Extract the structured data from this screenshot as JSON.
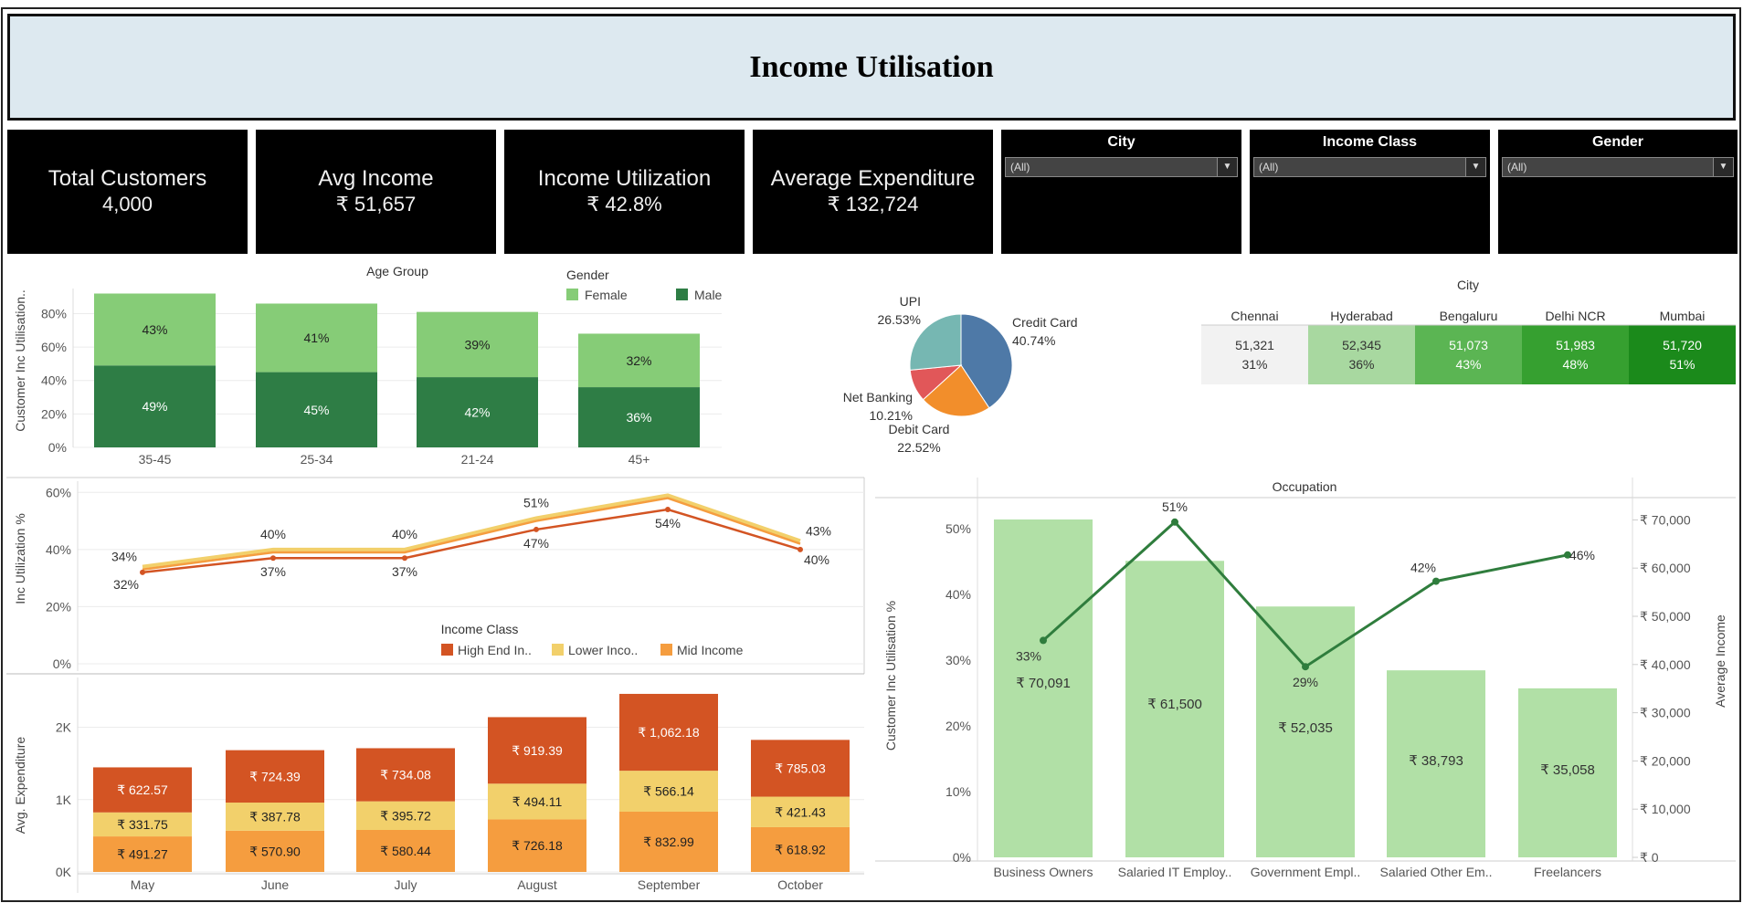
{
  "title": "Income Utilisation",
  "kpis": [
    {
      "label": "Total Customers",
      "value": "4,000"
    },
    {
      "label": "Avg Income",
      "value": "₹ 51,657"
    },
    {
      "label": "Income Utilization",
      "value": "₹ 42.8%"
    },
    {
      "label": "Average Expenditure",
      "value": "₹ 132,724"
    }
  ],
  "filters": [
    {
      "label": "City",
      "value": "(All)"
    },
    {
      "label": "Income Class",
      "value": "(All)"
    },
    {
      "label": "Gender",
      "value": "(All)"
    }
  ],
  "colors": {
    "female": "#86cc77",
    "male": "#2e7d45",
    "high_end": "#d35423",
    "lower": "#f2d06b",
    "mid": "#f59d3f",
    "occ_bar": "#b1e0a6",
    "occ_line": "#2f7d3d",
    "upi": "#76b7b2",
    "credit": "#4e79a7",
    "debit": "#f28e2b",
    "netbanking": "#e15759"
  },
  "chart_data": [
    {
      "id": "age_group",
      "type": "bar",
      "stacked": true,
      "title": "Age Group",
      "ylabel": "Customer Inc Utilisation..",
      "legend_title": "Gender",
      "categories": [
        "35-45",
        "25-34",
        "21-24",
        "45+"
      ],
      "series": [
        {
          "name": "Male",
          "values": [
            49,
            45,
            42,
            36
          ],
          "labels": [
            "49%",
            "45%",
            "42%",
            "36%"
          ]
        },
        {
          "name": "Female",
          "values": [
            43,
            41,
            39,
            32
          ],
          "labels": [
            "43%",
            "41%",
            "39%",
            "32%"
          ]
        }
      ],
      "yticks": [
        "0%",
        "20%",
        "40%",
        "60%",
        "80%"
      ],
      "ylim": [
        0,
        95
      ]
    },
    {
      "id": "payment",
      "type": "pie",
      "slices": [
        {
          "name": "Credit Card",
          "value": 40.74,
          "label": "40.74%"
        },
        {
          "name": "Debit Card",
          "value": 22.52,
          "label": "22.52%"
        },
        {
          "name": "Net Banking",
          "value": 10.21,
          "label": "10.21%"
        },
        {
          "name": "UPI",
          "value": 26.53,
          "label": "26.53%"
        }
      ]
    },
    {
      "id": "city",
      "type": "table",
      "title": "City",
      "columns": [
        "Chennai",
        "Hyderabad",
        "Bengaluru",
        "Delhi NCR",
        "Mumbai"
      ],
      "income": [
        "51,321",
        "52,345",
        "51,073",
        "51,983",
        "51,720"
      ],
      "utilisation": [
        "31%",
        "36%",
        "43%",
        "48%",
        "51%"
      ],
      "util_values": [
        31,
        36,
        43,
        48,
        51
      ],
      "fills": [
        "#f2f2f2",
        "#a8d8a0",
        "#5bb553",
        "#36a030",
        "#1b8a1b"
      ]
    },
    {
      "id": "util_trend",
      "type": "line",
      "ylabel": "Inc Utilization %",
      "legend_title": "Income Class",
      "categories": [
        "May",
        "June",
        "July",
        "August",
        "September",
        "October"
      ],
      "series": [
        {
          "name": "High End In..",
          "values": [
            32,
            37,
            37,
            47,
            54,
            40
          ],
          "labels": [
            "32%",
            "37%",
            "37%",
            "47%",
            "54%",
            "40%"
          ]
        },
        {
          "name": "Lower Inco..",
          "values": [
            34,
            40,
            40,
            51,
            59,
            43
          ],
          "labels": [
            "34%",
            "40%",
            "40%",
            "51%",
            "",
            "43%"
          ]
        },
        {
          "name": "Mid Income",
          "values": [
            33,
            39,
            39,
            50,
            58,
            42
          ]
        }
      ],
      "yticks": [
        "0%",
        "20%",
        "40%",
        "60%"
      ],
      "ylim": [
        0,
        62
      ]
    },
    {
      "id": "expenditure",
      "type": "bar",
      "stacked": true,
      "ylabel": "Avg. Expenditure",
      "categories": [
        "May",
        "June",
        "July",
        "August",
        "September",
        "October"
      ],
      "series": [
        {
          "name": "Mid Income",
          "values": [
            491.27,
            570.9,
            580.44,
            726.18,
            832.99,
            618.92
          ],
          "labels": [
            "₹ 491.27",
            "₹ 570.90",
            "₹ 580.44",
            "₹ 726.18",
            "₹ 832.99",
            "₹ 618.92"
          ]
        },
        {
          "name": "Lower Income",
          "values": [
            331.75,
            387.78,
            395.72,
            494.11,
            566.14,
            421.43
          ],
          "labels": [
            "₹ 331.75",
            "₹ 387.78",
            "₹ 395.72",
            "₹ 494.11",
            "₹ 566.14",
            "₹ 421.43"
          ]
        },
        {
          "name": "High End Income",
          "values": [
            622.57,
            724.39,
            734.08,
            919.39,
            1062.18,
            785.03
          ],
          "labels": [
            "₹ 622.57",
            "₹ 724.39",
            "₹ 734.08",
            "₹ 919.39",
            "₹ 1,062.18",
            "₹ 785.03"
          ]
        }
      ],
      "yticks": [
        "0K",
        "1K",
        "2K"
      ],
      "ylim": [
        0,
        2650
      ]
    },
    {
      "id": "occupation",
      "type": "bar",
      "title": "Occupation",
      "ylabel": "Customer Inc Utilisation %",
      "y2label": "Average Income",
      "categories": [
        "Business Owners",
        "Salaried IT Employ..",
        "Government Empl..",
        "Salaried Other Em..",
        "Freelancers"
      ],
      "bars": {
        "values": [
          70091,
          61500,
          52035,
          38793,
          35058
        ],
        "labels": [
          "₹ 70,091",
          "₹ 61,500",
          "₹ 52,035",
          "₹ 38,793",
          "₹ 35,058"
        ]
      },
      "line": {
        "values": [
          33,
          51,
          29,
          42,
          46
        ],
        "labels": [
          "33%",
          "51%",
          "29%",
          "42%",
          "46%"
        ]
      },
      "yticks": [
        "0%",
        "10%",
        "20%",
        "30%",
        "40%",
        "50%"
      ],
      "ylim": [
        0,
        55
      ],
      "y2ticks": [
        "₹ 0",
        "₹ 10,000",
        "₹ 20,000",
        "₹ 30,000",
        "₹ 40,000",
        "₹ 50,000",
        "₹ 60,000",
        "₹ 70,000"
      ],
      "y2lim": [
        0,
        75000
      ]
    }
  ]
}
